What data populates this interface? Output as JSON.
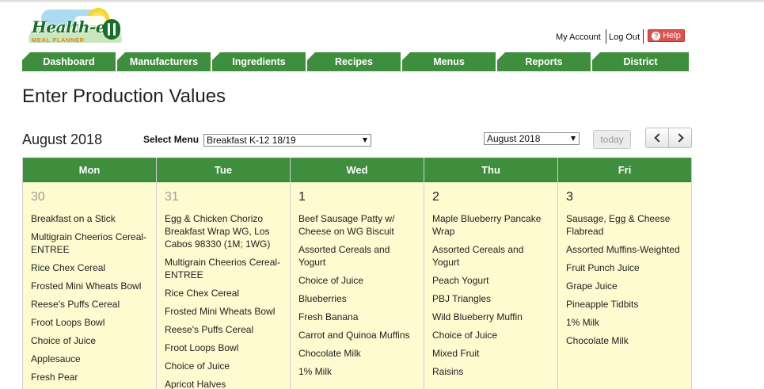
{
  "logo": {
    "brand": "Health-e",
    "subtitle": "MEAL PLANNER"
  },
  "account": {
    "my_account": "My Account",
    "log_out": "Log Out",
    "help": "Help"
  },
  "nav": {
    "tabs": [
      {
        "label": "Dashboard"
      },
      {
        "label": "Manufacturers"
      },
      {
        "label": "Ingredients"
      },
      {
        "label": "Recipes"
      },
      {
        "label": "Menus"
      },
      {
        "label": "Reports"
      },
      {
        "label": "District"
      }
    ]
  },
  "page": {
    "title": "Enter Production Values"
  },
  "toolbar": {
    "month_label": "August 2018",
    "select_menu_label": "Select Menu",
    "menu_value": "Breakfast K-12 18/19",
    "month_value": "August 2018",
    "today_label": "today"
  },
  "colors": {
    "nav_green": "#3f8e3d",
    "calendar_cell": "#fdfbcf",
    "help_red": "#d9534f"
  },
  "calendar": {
    "days": [
      {
        "name": "Mon",
        "date": "30",
        "muted": true,
        "items": [
          "Breakfast on a Stick",
          "Multigrain Cheerios Cereal-ENTREE",
          "Rice Chex Cereal",
          "Frosted Mini Wheats Bowl",
          "Reese's Puffs Cereal",
          "Froot Loops Bowl",
          "Choice of Juice",
          "Applesauce",
          "Fresh Pear"
        ]
      },
      {
        "name": "Tue",
        "date": "31",
        "muted": true,
        "items": [
          "Egg & Chicken Chorizo Breakfast Wrap WG, Los Cabos 98330 (1M; 1WG)",
          "Multigrain Cheerios Cereal-ENTREE",
          "Rice Chex Cereal",
          "Frosted Mini Wheats Bowl",
          "Reese's Puffs Cereal",
          "Froot Loops Bowl",
          "Choice of Juice",
          "Apricot Halves"
        ]
      },
      {
        "name": "Wed",
        "date": "1",
        "muted": false,
        "items": [
          "Beef Sausage Patty w/ Cheese on WG Biscuit",
          "Assorted Cereals and Yogurt",
          "Choice of Juice",
          "Blueberries",
          "Fresh Banana",
          "Carrot and Quinoa Muffins",
          "Chocolate Milk",
          "1% Milk"
        ]
      },
      {
        "name": "Thu",
        "date": "2",
        "muted": false,
        "items": [
          "Maple Blueberry Pancake Wrap",
          "Assorted Cereals and Yogurt",
          "Peach Yogurt",
          "PBJ Triangles",
          "Wild Blueberry Muffin",
          "Choice of Juice",
          "Mixed Fruit",
          "Raisins"
        ]
      },
      {
        "name": "Fri",
        "date": "3",
        "muted": false,
        "items": [
          "Sausage, Egg & Cheese Flabread",
          "Assorted Muffins-Weighted",
          "Fruit Punch Juice",
          "Grape Juice",
          "Pineapple Tidbits",
          "1% Milk",
          "Chocolate Milk"
        ]
      }
    ]
  }
}
